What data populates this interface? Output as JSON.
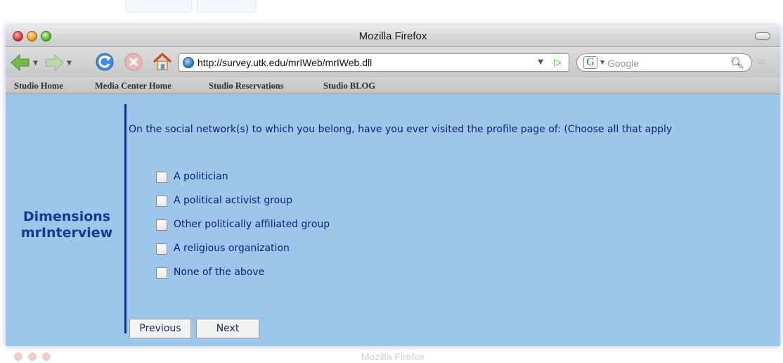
{
  "window": {
    "title": "Mozilla Firefox"
  },
  "navbar": {
    "url": "http://survey.utk.edu/mrIWeb/mrIWeb.dll",
    "search_engine_letter": "G",
    "search_placeholder": "Google",
    "back_icon": "back-arrow-icon",
    "forward_icon": "forward-arrow-icon",
    "reload_icon": "reload-icon",
    "stop_icon": "stop-icon",
    "home_icon": "home-icon"
  },
  "bookmarks": [
    "Studio Home",
    "Media Center Home",
    "Studio Reservations",
    "Studio BLOG"
  ],
  "survey": {
    "brand_line1": "Dimensions",
    "brand_line2": "mrInterview",
    "question": "On the social network(s) to which you belong, have you ever visited the profile page of: (Choose all that apply",
    "options": [
      "A politician",
      "A political activist group",
      "Other politically affiliated group",
      "A religious organization",
      "None of the above"
    ],
    "previous_label": "Previous",
    "next_label": "Next"
  },
  "reflection": {
    "title": "Mozilla Firefox"
  },
  "colors": {
    "content_background": "#9cc6ea",
    "brand_text": "#123b97",
    "divider": "#122c8f",
    "question_text": "#0b1f7a"
  }
}
